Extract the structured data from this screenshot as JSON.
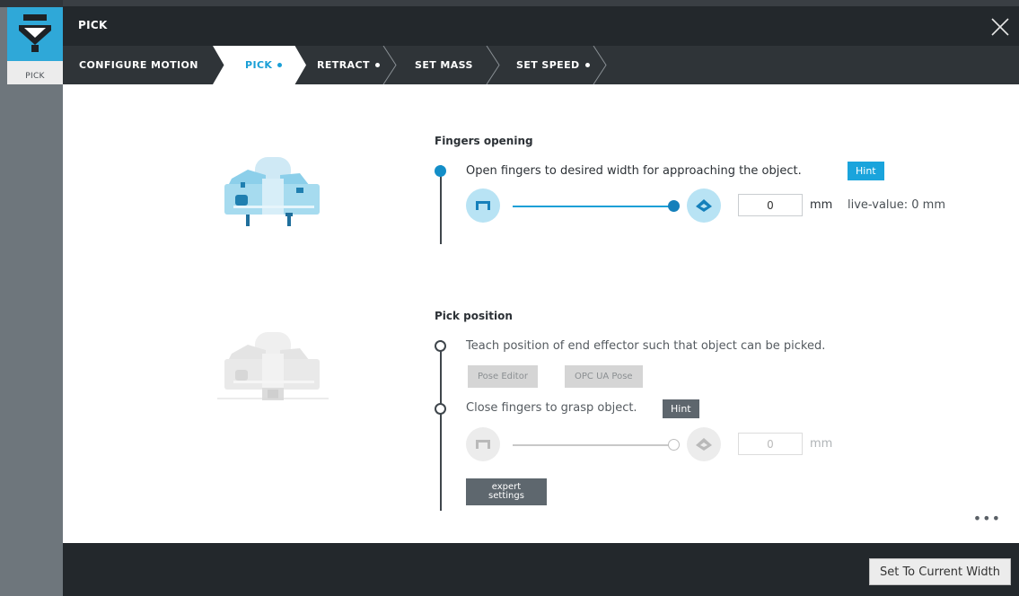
{
  "rail": {
    "app_label": "PICK",
    "icon": "gripper-app-icon"
  },
  "titlebar": {
    "title": "PICK",
    "close_icon": "close-icon"
  },
  "steps": [
    {
      "label": "CONFIGURE MOTION",
      "dot": false,
      "active": false
    },
    {
      "label": "PICK",
      "dot": true,
      "active": true
    },
    {
      "label": "RETRACT",
      "dot": true,
      "active": false
    },
    {
      "label": "SET MASS",
      "dot": false,
      "active": false
    },
    {
      "label": "SET SPEED",
      "dot": true,
      "active": false
    }
  ],
  "fingers_opening": {
    "title": "Fingers opening",
    "instruction": "Open fingers to desired width for approaching the object.",
    "hint_label": "Hint",
    "slider_value_fraction": 1.0,
    "width_value": "0",
    "unit": "mm",
    "live_value": "live-value: 0 mm"
  },
  "pick_position": {
    "title": "Pick position",
    "teach_instruction": "Teach position of end effector such that object can be picked.",
    "pose_editor_label": "Pose Editor",
    "opc_ua_pose_label": "OPC UA Pose",
    "close_instruction": "Close fingers to grasp object.",
    "hint_label": "Hint",
    "slider_value_fraction": 1.0,
    "width_value": "0",
    "unit": "mm",
    "expert_line1": "expert",
    "expert_line2": "settings"
  },
  "more_label": "•••",
  "footer": {
    "button_label": "Set To Current Width"
  },
  "colors": {
    "accent": "#1aa4dc",
    "dark": "#23282c",
    "rail": "#6e767c"
  }
}
